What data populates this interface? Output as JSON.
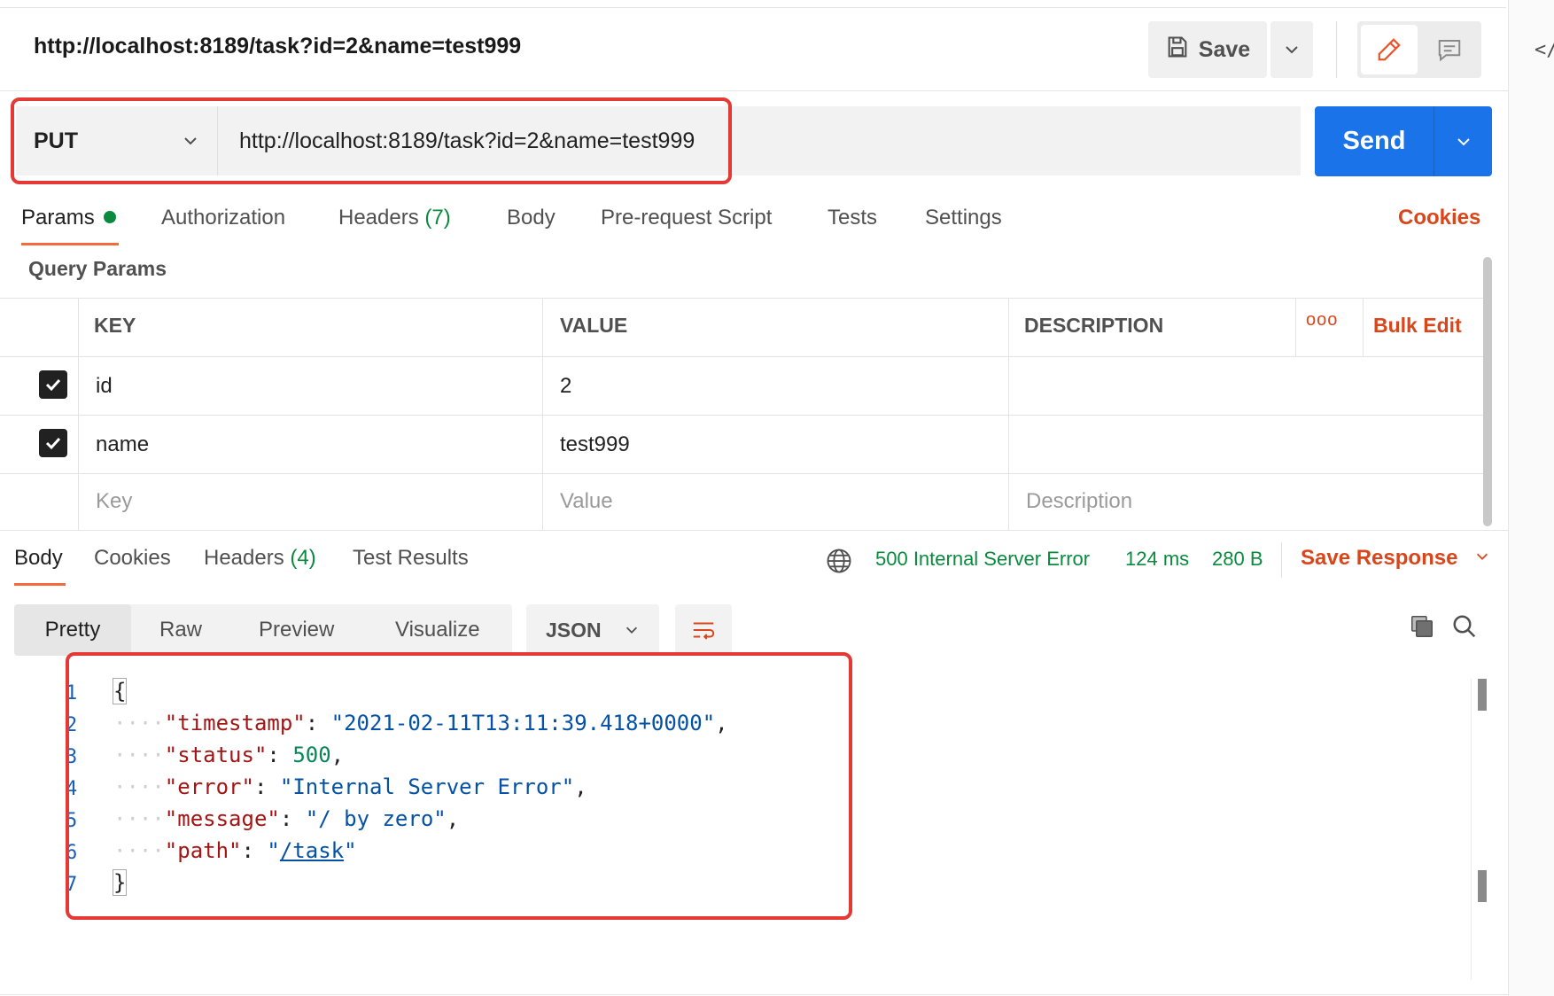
{
  "request": {
    "title": "http://localhost:8189/task?id=2&name=test999",
    "method": "PUT",
    "url": "http://localhost:8189/task?id=2&name=test999"
  },
  "toolbar": {
    "save_label": "Save",
    "send_label": "Send",
    "code_icon": "</"
  },
  "request_tabs": [
    {
      "label": "Params"
    },
    {
      "label": "Authorization"
    },
    {
      "label": "Headers",
      "count": "(7)"
    },
    {
      "label": "Body"
    },
    {
      "label": "Pre-request Script"
    },
    {
      "label": "Tests"
    },
    {
      "label": "Settings"
    }
  ],
  "cookies_label": "Cookies",
  "query_params": {
    "title": "Query Params",
    "headers": {
      "key": "KEY",
      "value": "VALUE",
      "description": "DESCRIPTION"
    },
    "bulk_edit": "Bulk Edit",
    "more": "ooo",
    "rows": [
      {
        "key": "id",
        "value": "2",
        "description": "",
        "checked": true
      },
      {
        "key": "name",
        "value": "test999",
        "description": "",
        "checked": true
      }
    ],
    "placeholders": {
      "key": "Key",
      "value": "Value",
      "description": "Description"
    }
  },
  "response": {
    "tabs": [
      {
        "label": "Body"
      },
      {
        "label": "Cookies"
      },
      {
        "label": "Headers",
        "count": "(4)"
      },
      {
        "label": "Test Results"
      }
    ],
    "status": "500 Internal Server Error",
    "time": "124 ms",
    "size": "280 B",
    "save_response": "Save Response",
    "views": [
      "Pretty",
      "Raw",
      "Preview",
      "Visualize"
    ],
    "format": "JSON",
    "line_numbers": [
      "1",
      "2",
      "3",
      "4",
      "5",
      "6",
      "7"
    ],
    "body": {
      "timestamp_key": "timestamp",
      "timestamp_val": "2021-02-11T13:11:39.418+0000",
      "status_key": "status",
      "status_val": "500",
      "error_key": "error",
      "error_val": "Internal Server Error",
      "message_key": "message",
      "message_val": "/ by zero",
      "path_key": "path",
      "path_val": "/task"
    }
  },
  "colors": {
    "accent": "#f26b3a",
    "send_blue": "#1a73e8",
    "status_green": "#0a8a3e",
    "link_orange": "#d9461b",
    "annotation_red": "#e53935"
  }
}
